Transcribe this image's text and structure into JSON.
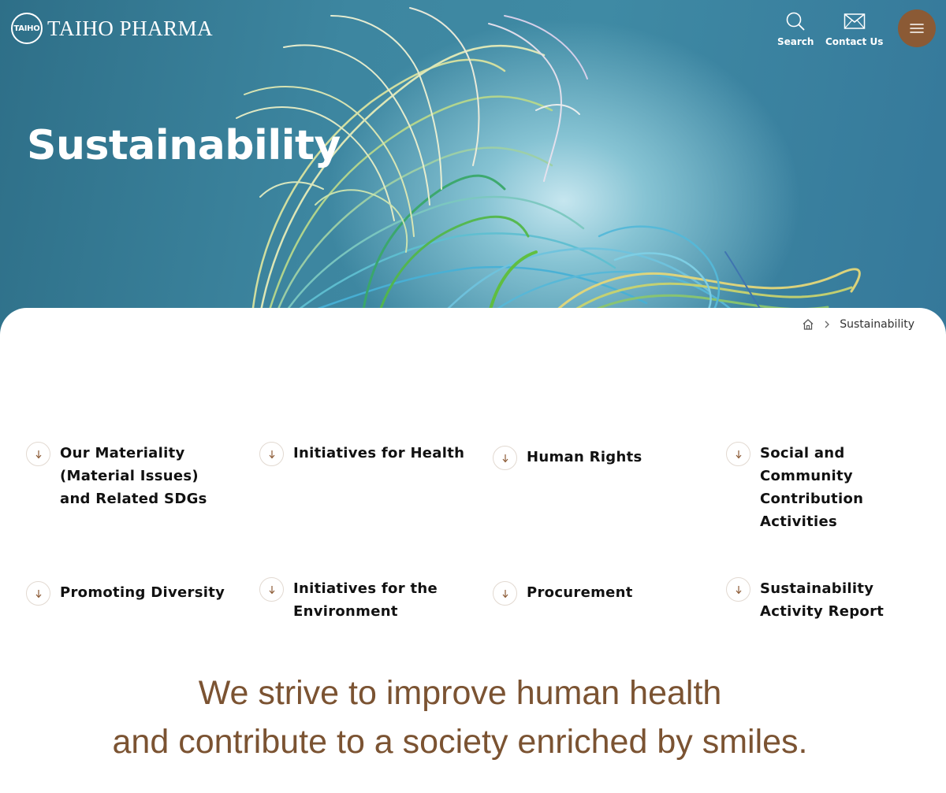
{
  "header": {
    "logo_mark": "TAIHO",
    "logo_text": "TAIHO PHARMA",
    "search_label": "Search",
    "contact_label": "Contact Us",
    "menu_icon": "hamburger-icon"
  },
  "hero": {
    "title": "Sustainability"
  },
  "breadcrumb": {
    "home_icon": "home-icon",
    "current": "Sustainability"
  },
  "anchors": [
    {
      "label": "Our Materiality (Material Issues) and Related SDGs"
    },
    {
      "label": "Initiatives for Health"
    },
    {
      "label": "Human Rights"
    },
    {
      "label": "Social and Community Contribution Activities"
    },
    {
      "label": "Promoting Diversity"
    },
    {
      "label": "Initiatives for the Environment"
    },
    {
      "label": "Procurement"
    },
    {
      "label": "Sustainability Activity Report"
    }
  ],
  "tagline": {
    "line1": "We strive to improve human health",
    "line2": "and contribute to a society enriched by smiles."
  },
  "colors": {
    "accent_brown": "#8b5a35",
    "tagline_brown": "#7b5332",
    "hero_teal": "#3d86a0"
  }
}
